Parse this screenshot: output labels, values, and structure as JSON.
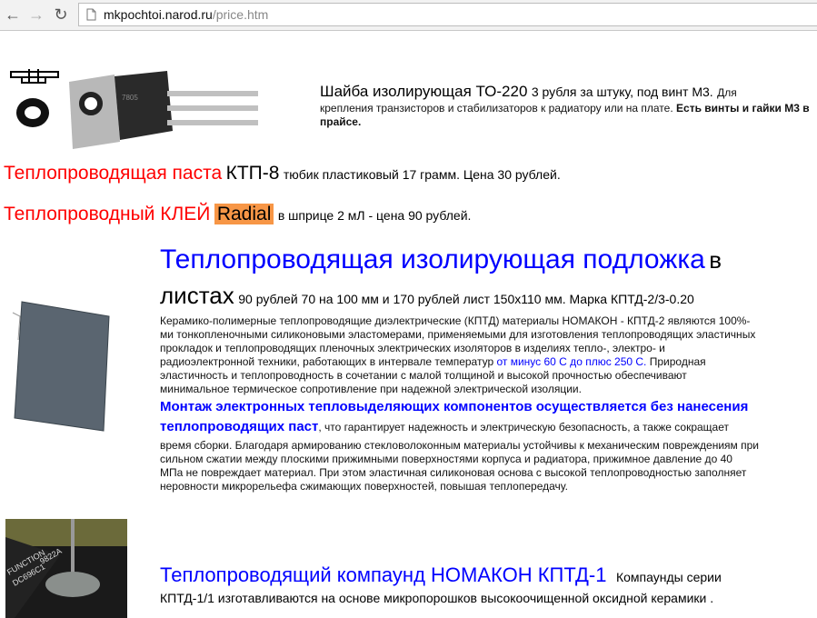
{
  "browser": {
    "url_host": "mkpochtoi.narod.ru",
    "url_path": "/price.htm"
  },
  "washer": {
    "title": "Шайба изолирующая ТО-220",
    "price": "3 рубля за штуку, под винт М3.",
    "desc1": "Для",
    "desc2": "крепления транзисторов и стабилизаторов к радиатору или на плате.",
    "bold_note": "Есть винты и гайки М3 в прайсе."
  },
  "paste": {
    "name": "Теплопроводящая паста",
    "model": "КТП-8",
    "desc": "тюбик пластиковый 17 грамм. Цена 30 рублей."
  },
  "glue": {
    "name": "Теплопроводный КЛЕЙ",
    "brand": "Radial",
    "desc": "в шприце 2 мЛ  - цена 90 рублей."
  },
  "pad": {
    "title_blue": "Теплопроводящая изолирующая подложка",
    "title_tail_1": "в",
    "title_tail_2": "листах",
    "price": "90 рублей 70 на 100 мм и 170 рублей лист 150х110 мм. Марка КПТД-2/3-0.20",
    "p1_lines": [
      "Керамико-полимерные теплопроводящие диэлектрические (КПТД) материалы НОМАКОН - КПТД-2 являются 100%-",
      "ми тонкопленочными силиконовыми эластомерами, применяемыми для изготовления теплопроводящих эластичных",
      "прокладок и теплопроводящих пленочных электрических изоляторов в изделиях тепло-, электро- и"
    ],
    "p1_line4_a": "радиоэлектронной техники, работающих в интервале температур",
    "p1_line4_blue": "от минус 60 С до плюс 250 С.",
    "p1_line4_b": "Природная",
    "p1_tail_lines": [
      "эластичность и теплопроводность в сочетании с малой толщиной и высокой прочностью обеспечивают",
      "минимальное термическое сопротивление при надежной электрической изоляции."
    ],
    "mount_bold_1": "Монтаж электронных тепловыделяющих компонентов осуществляется без нанесения",
    "mount_bold_2": "теплопроводящих паст",
    "mount_rest_2": ", что гарантирует надежность и электрическую безопасность, а также сокращает",
    "p2_lines": [
      "время сборки.  Благодаря армированию стекловолоконным материалы устойчивы к механическим повреждениям при",
      "сильном сжатии между плоскими прижимными поверхностями корпуса и радиатора, прижимное давление до 40",
      "МПа не повреждает материал. При этом эластичная силиконовая основа с высокой теплопроводностью заполняет",
      "неровности микрорельефа сжимающих поверхностей, повышая теплопередачу."
    ]
  },
  "compound": {
    "title": "Теплопроводящий компаунд НОМАКОН КПТД-1",
    "tail": "Компаунды серии",
    "line2": "КПТД-1/1 изготавливаются на основе микропорошков высокоочищенной оксидной керамики .",
    "photo_labels": [
      "FUNCTION",
      "DC696C1",
      "9822A"
    ]
  },
  "colors": {
    "red": "#ff0000",
    "blue": "#0000ff",
    "highlight": "#f79646"
  }
}
